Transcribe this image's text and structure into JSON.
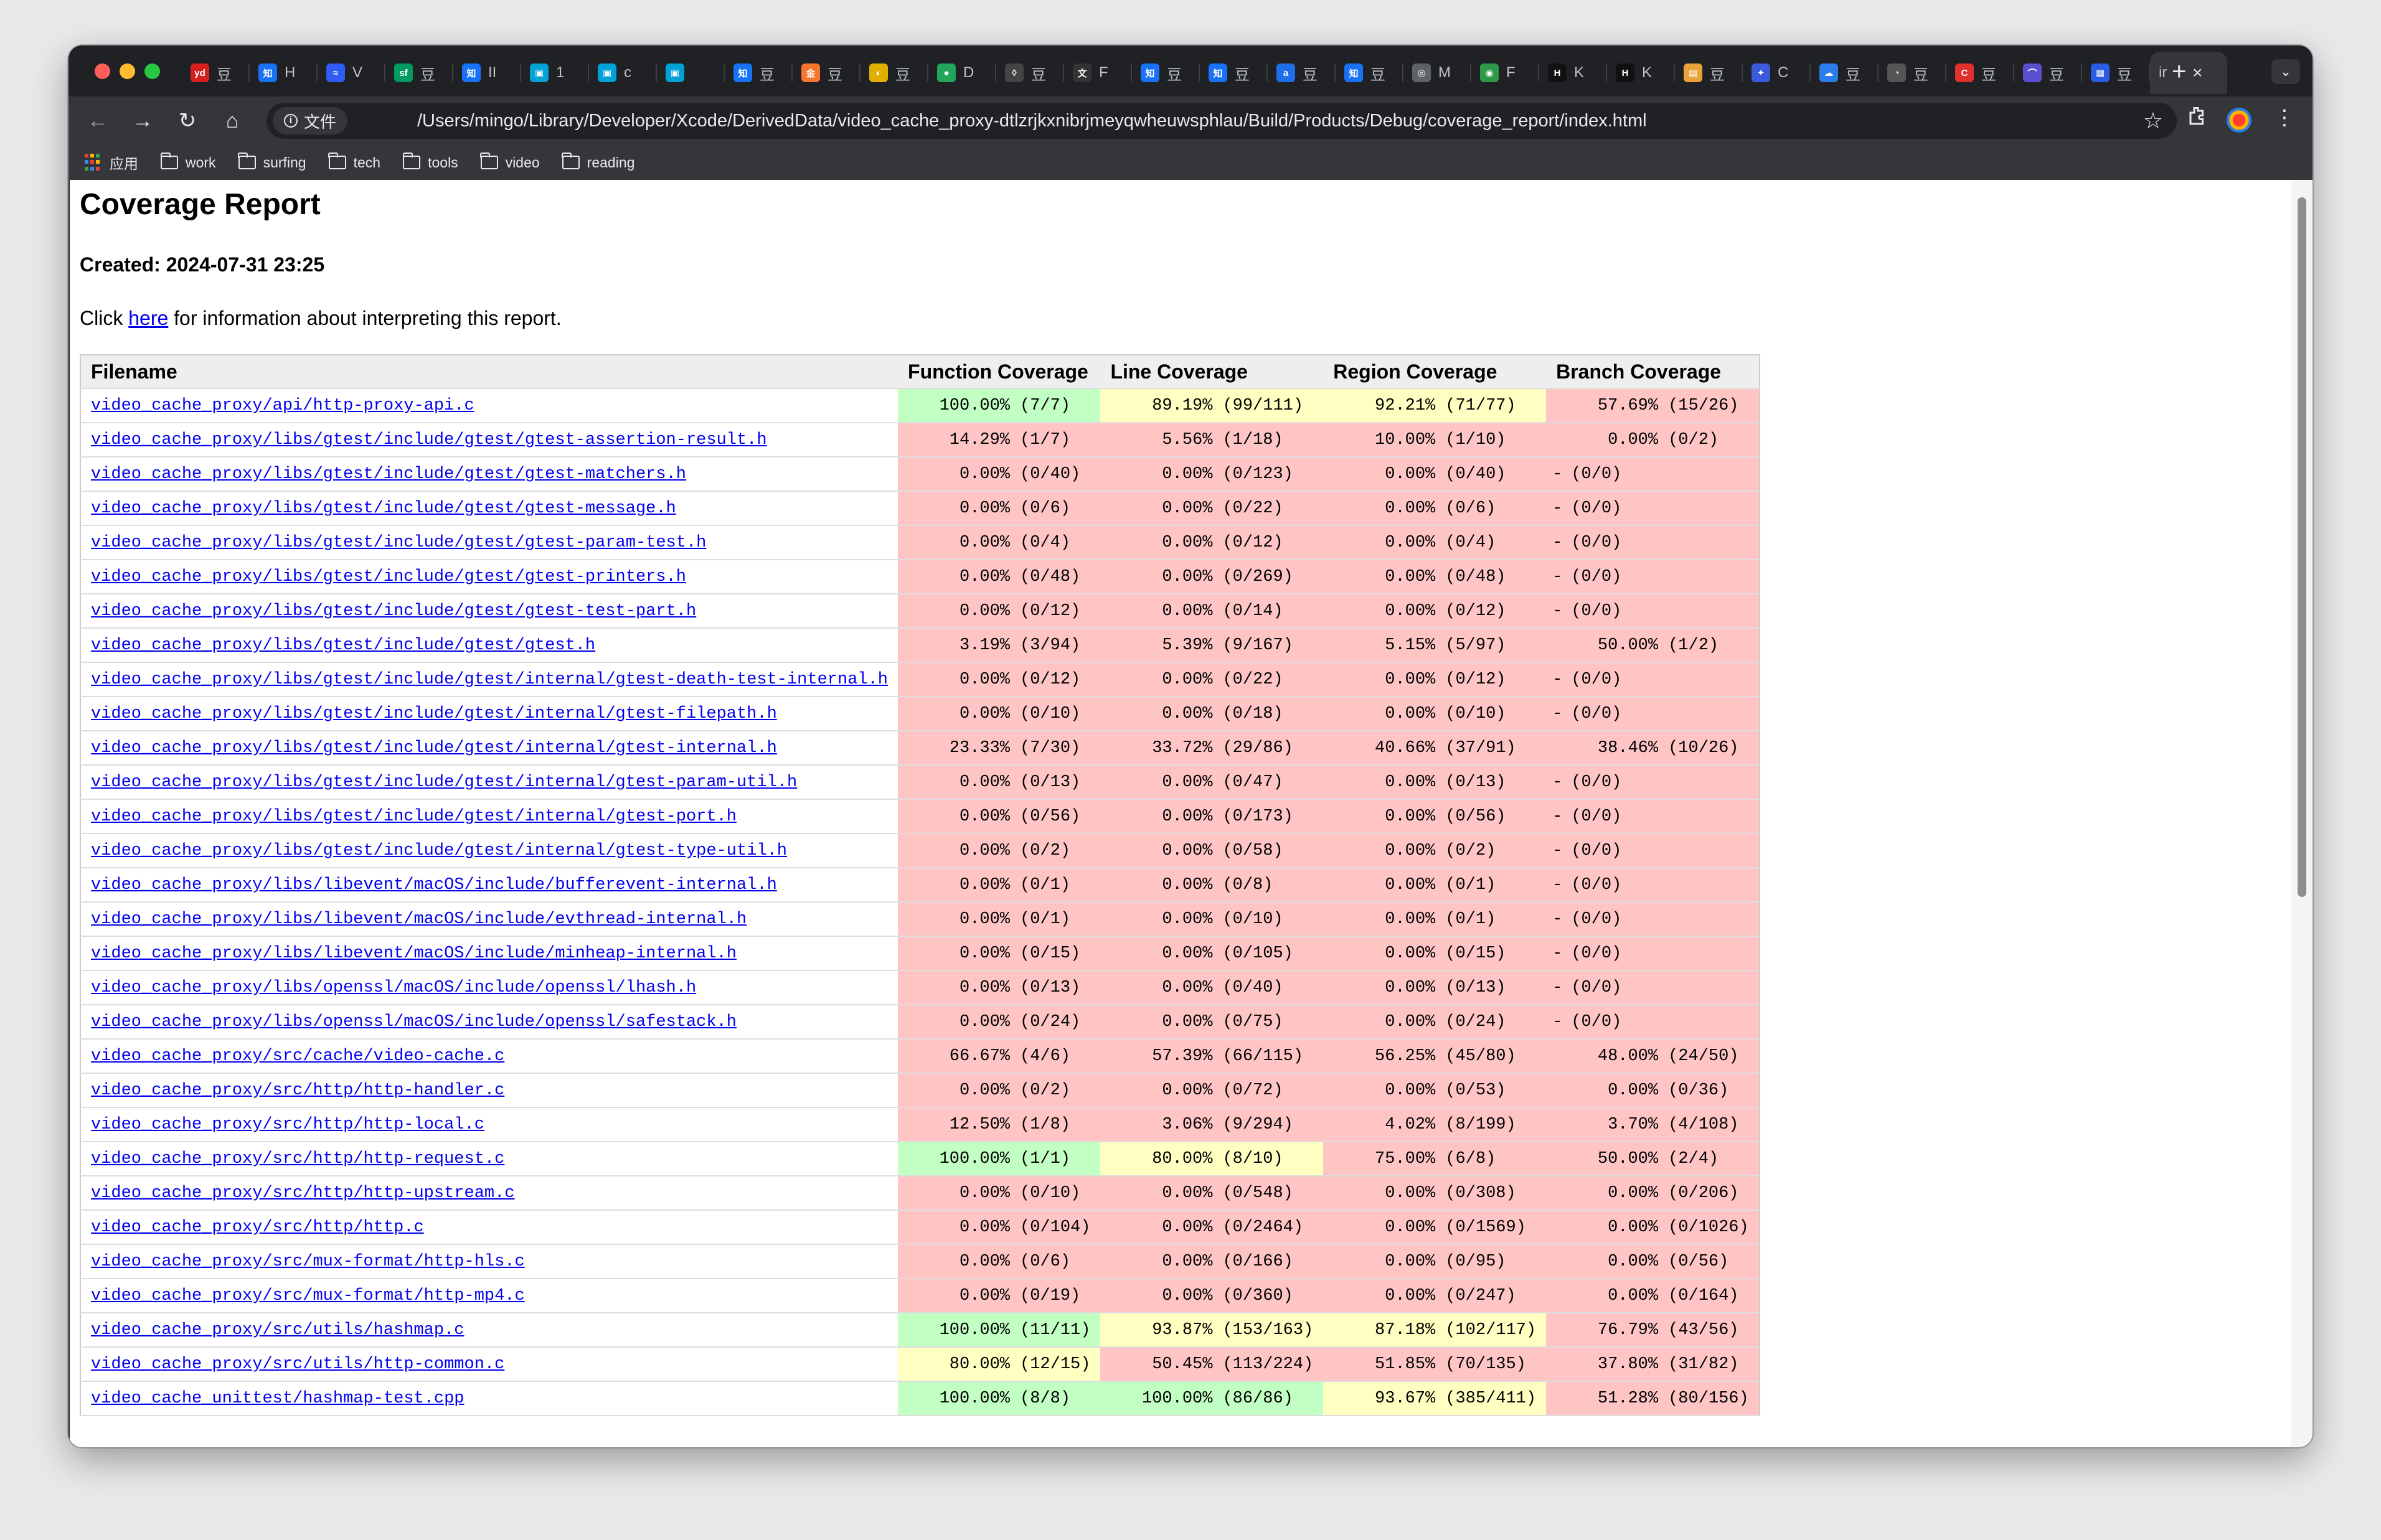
{
  "browser": {
    "tabs": [
      {
        "fav_text": "yd",
        "fav_color": "#d6201f",
        "label": "豆"
      },
      {
        "fav_text": "知",
        "fav_color": "#1772f6",
        "label": "H"
      },
      {
        "fav_text": "≈",
        "fav_color": "#2f5cf5",
        "label": "V"
      },
      {
        "fav_text": "sf",
        "fav_color": "#019a61",
        "label": "豆"
      },
      {
        "fav_text": "知",
        "fav_color": "#1772f6",
        "label": "II"
      },
      {
        "fav_text": "▣",
        "fav_color": "#00a1d6",
        "label": "1"
      },
      {
        "fav_text": "▣",
        "fav_color": "#00a1d6",
        "label": "c"
      },
      {
        "fav_text": "▣",
        "fav_color": "#00a1d6",
        "label": ""
      },
      {
        "fav_text": "知",
        "fav_color": "#1772f6",
        "label": "豆"
      },
      {
        "fav_text": "金",
        "fav_color": "#f7762d",
        "label": "豆"
      },
      {
        "fav_text": "◐",
        "fav_color": "#e0b000",
        "label": "豆"
      },
      {
        "fav_text": "●",
        "fav_color": "#23a55a",
        "label": "D"
      },
      {
        "fav_text": "◊",
        "fav_color": "#444444",
        "label": "豆"
      },
      {
        "fav_text": "文",
        "fav_color": "#333333",
        "label": "F"
      },
      {
        "fav_text": "知",
        "fav_color": "#1772f6",
        "label": "豆"
      },
      {
        "fav_text": "知",
        "fav_color": "#1772f6",
        "label": "豆"
      },
      {
        "fav_text": "a",
        "fav_color": "#1f6feb",
        "label": "豆"
      },
      {
        "fav_text": "知",
        "fav_color": "#1772f6",
        "label": "豆"
      },
      {
        "fav_text": "◎",
        "fav_color": "#5f6368",
        "label": "M"
      },
      {
        "fav_text": "◉",
        "fav_color": "#2e9a48",
        "label": "F"
      },
      {
        "fav_text": "H",
        "fav_color": "#111111",
        "label": "K"
      },
      {
        "fav_text": "H",
        "fav_color": "#111111",
        "label": "K"
      },
      {
        "fav_text": "▤",
        "fav_color": "#e8a33a",
        "label": "豆"
      },
      {
        "fav_text": "✦",
        "fav_color": "#3b5bdb",
        "label": "C"
      },
      {
        "fav_text": "☁",
        "fav_color": "#2b7de9",
        "label": "豆"
      },
      {
        "fav_text": "◔",
        "fav_color": "#555555",
        "label": "豆"
      },
      {
        "fav_text": "C",
        "fav_color": "#e03131",
        "label": "豆"
      },
      {
        "fav_text": "⌒",
        "fav_color": "#5a4fcf",
        "label": "豆"
      },
      {
        "fav_text": "▦",
        "fav_color": "#2b5ce6",
        "label": "豆"
      }
    ],
    "active_tab": {
      "label": "ir"
    },
    "address": {
      "security_label": "文件",
      "url": "/Users/mingo/Library/Developer/Xcode/DerivedData/video_cache_proxy-dtlzrjkxnibrjmeyqwheuwsphlau/Build/Products/Debug/coverage_report/index.html"
    },
    "bookmarks": {
      "apps_label": "应用",
      "apps_colors": [
        "#ea4335",
        "#fbbc05",
        "#34a853",
        "#4285f4",
        "#ea4335",
        "#fbbc05",
        "#34a853",
        "#4285f4",
        "#ea4335"
      ],
      "folders": [
        "work",
        "surfing",
        "tech",
        "tools",
        "video",
        "reading"
      ]
    }
  },
  "report": {
    "title": "Coverage Report",
    "created": "Created: 2024-07-31 23:25",
    "intro_before": "Click ",
    "intro_link": "here",
    "intro_after": " for information about interpreting this report.",
    "columns": [
      "Filename",
      "Function Coverage",
      "Line Coverage",
      "Region Coverage",
      "Branch Coverage"
    ],
    "rows": [
      {
        "file": "video_cache_proxy/api/http-proxy-api.c",
        "function": "100.00% (7/7)",
        "line": "89.19% (99/111)",
        "region": "92.21% (71/77)",
        "branch": "57.69% (15/26)",
        "colors": [
          "green",
          "yellow",
          "yellow",
          "red"
        ]
      },
      {
        "file": "video_cache_proxy/libs/gtest/include/gtest/gtest-assertion-result.h",
        "function": "14.29% (1/7)",
        "line": "5.56% (1/18)",
        "region": "10.00% (1/10)",
        "branch": "0.00% (0/2)",
        "colors": [
          "red",
          "red",
          "red",
          "red"
        ]
      },
      {
        "file": "video_cache_proxy/libs/gtest/include/gtest/gtest-matchers.h",
        "function": "0.00% (0/40)",
        "line": "0.00% (0/123)",
        "region": "0.00% (0/40)",
        "branch": "- (0/0)",
        "colors": [
          "red",
          "red",
          "red",
          "red"
        ]
      },
      {
        "file": "video_cache_proxy/libs/gtest/include/gtest/gtest-message.h",
        "function": "0.00% (0/6)",
        "line": "0.00% (0/22)",
        "region": "0.00% (0/6)",
        "branch": "- (0/0)",
        "colors": [
          "red",
          "red",
          "red",
          "red"
        ]
      },
      {
        "file": "video_cache_proxy/libs/gtest/include/gtest/gtest-param-test.h",
        "function": "0.00% (0/4)",
        "line": "0.00% (0/12)",
        "region": "0.00% (0/4)",
        "branch": "- (0/0)",
        "colors": [
          "red",
          "red",
          "red",
          "red"
        ]
      },
      {
        "file": "video_cache_proxy/libs/gtest/include/gtest/gtest-printers.h",
        "function": "0.00% (0/48)",
        "line": "0.00% (0/269)",
        "region": "0.00% (0/48)",
        "branch": "- (0/0)",
        "colors": [
          "red",
          "red",
          "red",
          "red"
        ]
      },
      {
        "file": "video_cache_proxy/libs/gtest/include/gtest/gtest-test-part.h",
        "function": "0.00% (0/12)",
        "line": "0.00% (0/14)",
        "region": "0.00% (0/12)",
        "branch": "- (0/0)",
        "colors": [
          "red",
          "red",
          "red",
          "red"
        ]
      },
      {
        "file": "video_cache_proxy/libs/gtest/include/gtest/gtest.h",
        "function": "3.19% (3/94)",
        "line": "5.39% (9/167)",
        "region": "5.15% (5/97)",
        "branch": "50.00% (1/2)",
        "colors": [
          "red",
          "red",
          "red",
          "red"
        ]
      },
      {
        "file": "video_cache_proxy/libs/gtest/include/gtest/internal/gtest-death-test-internal.h",
        "function": "0.00% (0/12)",
        "line": "0.00% (0/22)",
        "region": "0.00% (0/12)",
        "branch": "- (0/0)",
        "colors": [
          "red",
          "red",
          "red",
          "red"
        ]
      },
      {
        "file": "video_cache_proxy/libs/gtest/include/gtest/internal/gtest-filepath.h",
        "function": "0.00% (0/10)",
        "line": "0.00% (0/18)",
        "region": "0.00% (0/10)",
        "branch": "- (0/0)",
        "colors": [
          "red",
          "red",
          "red",
          "red"
        ]
      },
      {
        "file": "video_cache_proxy/libs/gtest/include/gtest/internal/gtest-internal.h",
        "function": "23.33% (7/30)",
        "line": "33.72% (29/86)",
        "region": "40.66% (37/91)",
        "branch": "38.46% (10/26)",
        "colors": [
          "red",
          "red",
          "red",
          "red"
        ]
      },
      {
        "file": "video_cache_proxy/libs/gtest/include/gtest/internal/gtest-param-util.h",
        "function": "0.00% (0/13)",
        "line": "0.00% (0/47)",
        "region": "0.00% (0/13)",
        "branch": "- (0/0)",
        "colors": [
          "red",
          "red",
          "red",
          "red"
        ]
      },
      {
        "file": "video_cache_proxy/libs/gtest/include/gtest/internal/gtest-port.h",
        "function": "0.00% (0/56)",
        "line": "0.00% (0/173)",
        "region": "0.00% (0/56)",
        "branch": "- (0/0)",
        "colors": [
          "red",
          "red",
          "red",
          "red"
        ]
      },
      {
        "file": "video_cache_proxy/libs/gtest/include/gtest/internal/gtest-type-util.h",
        "function": "0.00% (0/2)",
        "line": "0.00% (0/58)",
        "region": "0.00% (0/2)",
        "branch": "- (0/0)",
        "colors": [
          "red",
          "red",
          "red",
          "red"
        ]
      },
      {
        "file": "video_cache_proxy/libs/libevent/macOS/include/bufferevent-internal.h",
        "function": "0.00% (0/1)",
        "line": "0.00% (0/8)",
        "region": "0.00% (0/1)",
        "branch": "- (0/0)",
        "colors": [
          "red",
          "red",
          "red",
          "red"
        ]
      },
      {
        "file": "video_cache_proxy/libs/libevent/macOS/include/evthread-internal.h",
        "function": "0.00% (0/1)",
        "line": "0.00% (0/10)",
        "region": "0.00% (0/1)",
        "branch": "- (0/0)",
        "colors": [
          "red",
          "red",
          "red",
          "red"
        ]
      },
      {
        "file": "video_cache_proxy/libs/libevent/macOS/include/minheap-internal.h",
        "function": "0.00% (0/15)",
        "line": "0.00% (0/105)",
        "region": "0.00% (0/15)",
        "branch": "- (0/0)",
        "colors": [
          "red",
          "red",
          "red",
          "red"
        ]
      },
      {
        "file": "video_cache_proxy/libs/openssl/macOS/include/openssl/lhash.h",
        "function": "0.00% (0/13)",
        "line": "0.00% (0/40)",
        "region": "0.00% (0/13)",
        "branch": "- (0/0)",
        "colors": [
          "red",
          "red",
          "red",
          "red"
        ]
      },
      {
        "file": "video_cache_proxy/libs/openssl/macOS/include/openssl/safestack.h",
        "function": "0.00% (0/24)",
        "line": "0.00% (0/75)",
        "region": "0.00% (0/24)",
        "branch": "- (0/0)",
        "colors": [
          "red",
          "red",
          "red",
          "red"
        ]
      },
      {
        "file": "video_cache_proxy/src/cache/video-cache.c",
        "function": "66.67% (4/6)",
        "line": "57.39% (66/115)",
        "region": "56.25% (45/80)",
        "branch": "48.00% (24/50)",
        "colors": [
          "red",
          "red",
          "red",
          "red"
        ]
      },
      {
        "file": "video_cache_proxy/src/http/http-handler.c",
        "function": "0.00% (0/2)",
        "line": "0.00% (0/72)",
        "region": "0.00% (0/53)",
        "branch": "0.00% (0/36)",
        "colors": [
          "red",
          "red",
          "red",
          "red"
        ]
      },
      {
        "file": "video_cache_proxy/src/http/http-local.c",
        "function": "12.50% (1/8)",
        "line": "3.06% (9/294)",
        "region": "4.02% (8/199)",
        "branch": "3.70% (4/108)",
        "colors": [
          "red",
          "red",
          "red",
          "red"
        ]
      },
      {
        "file": "video_cache_proxy/src/http/http-request.c",
        "function": "100.00% (1/1)",
        "line": "80.00% (8/10)",
        "region": "75.00% (6/8)",
        "branch": "50.00% (2/4)",
        "colors": [
          "green",
          "yellow",
          "red",
          "red"
        ]
      },
      {
        "file": "video_cache_proxy/src/http/http-upstream.c",
        "function": "0.00% (0/10)",
        "line": "0.00% (0/548)",
        "region": "0.00% (0/308)",
        "branch": "0.00% (0/206)",
        "colors": [
          "red",
          "red",
          "red",
          "red"
        ]
      },
      {
        "file": "video_cache_proxy/src/http/http.c",
        "function": "0.00% (0/104)",
        "line": "0.00% (0/2464)",
        "region": "0.00% (0/1569)",
        "branch": "0.00% (0/1026)",
        "colors": [
          "red",
          "red",
          "red",
          "red"
        ]
      },
      {
        "file": "video_cache_proxy/src/mux-format/http-hls.c",
        "function": "0.00% (0/6)",
        "line": "0.00% (0/166)",
        "region": "0.00% (0/95)",
        "branch": "0.00% (0/56)",
        "colors": [
          "red",
          "red",
          "red",
          "red"
        ]
      },
      {
        "file": "video_cache_proxy/src/mux-format/http-mp4.c",
        "function": "0.00% (0/19)",
        "line": "0.00% (0/360)",
        "region": "0.00% (0/247)",
        "branch": "0.00% (0/164)",
        "colors": [
          "red",
          "red",
          "red",
          "red"
        ]
      },
      {
        "file": "video_cache_proxy/src/utils/hashmap.c",
        "function": "100.00% (11/11)",
        "line": "93.87% (153/163)",
        "region": "87.18% (102/117)",
        "branch": "76.79% (43/56)",
        "colors": [
          "green",
          "yellow",
          "yellow",
          "red"
        ]
      },
      {
        "file": "video_cache_proxy/src/utils/http-common.c",
        "function": "80.00% (12/15)",
        "line": "50.45% (113/224)",
        "region": "51.85% (70/135)",
        "branch": "37.80% (31/82)",
        "colors": [
          "yellow",
          "red",
          "red",
          "red"
        ]
      },
      {
        "file": "video_cache_unittest/hashmap-test.cpp",
        "function": "100.00% (8/8)",
        "line": "100.00% (86/86)",
        "region": "93.67% (385/411)",
        "branch": "51.28% (80/156)",
        "colors": [
          "green",
          "green",
          "yellow",
          "red"
        ]
      }
    ]
  }
}
